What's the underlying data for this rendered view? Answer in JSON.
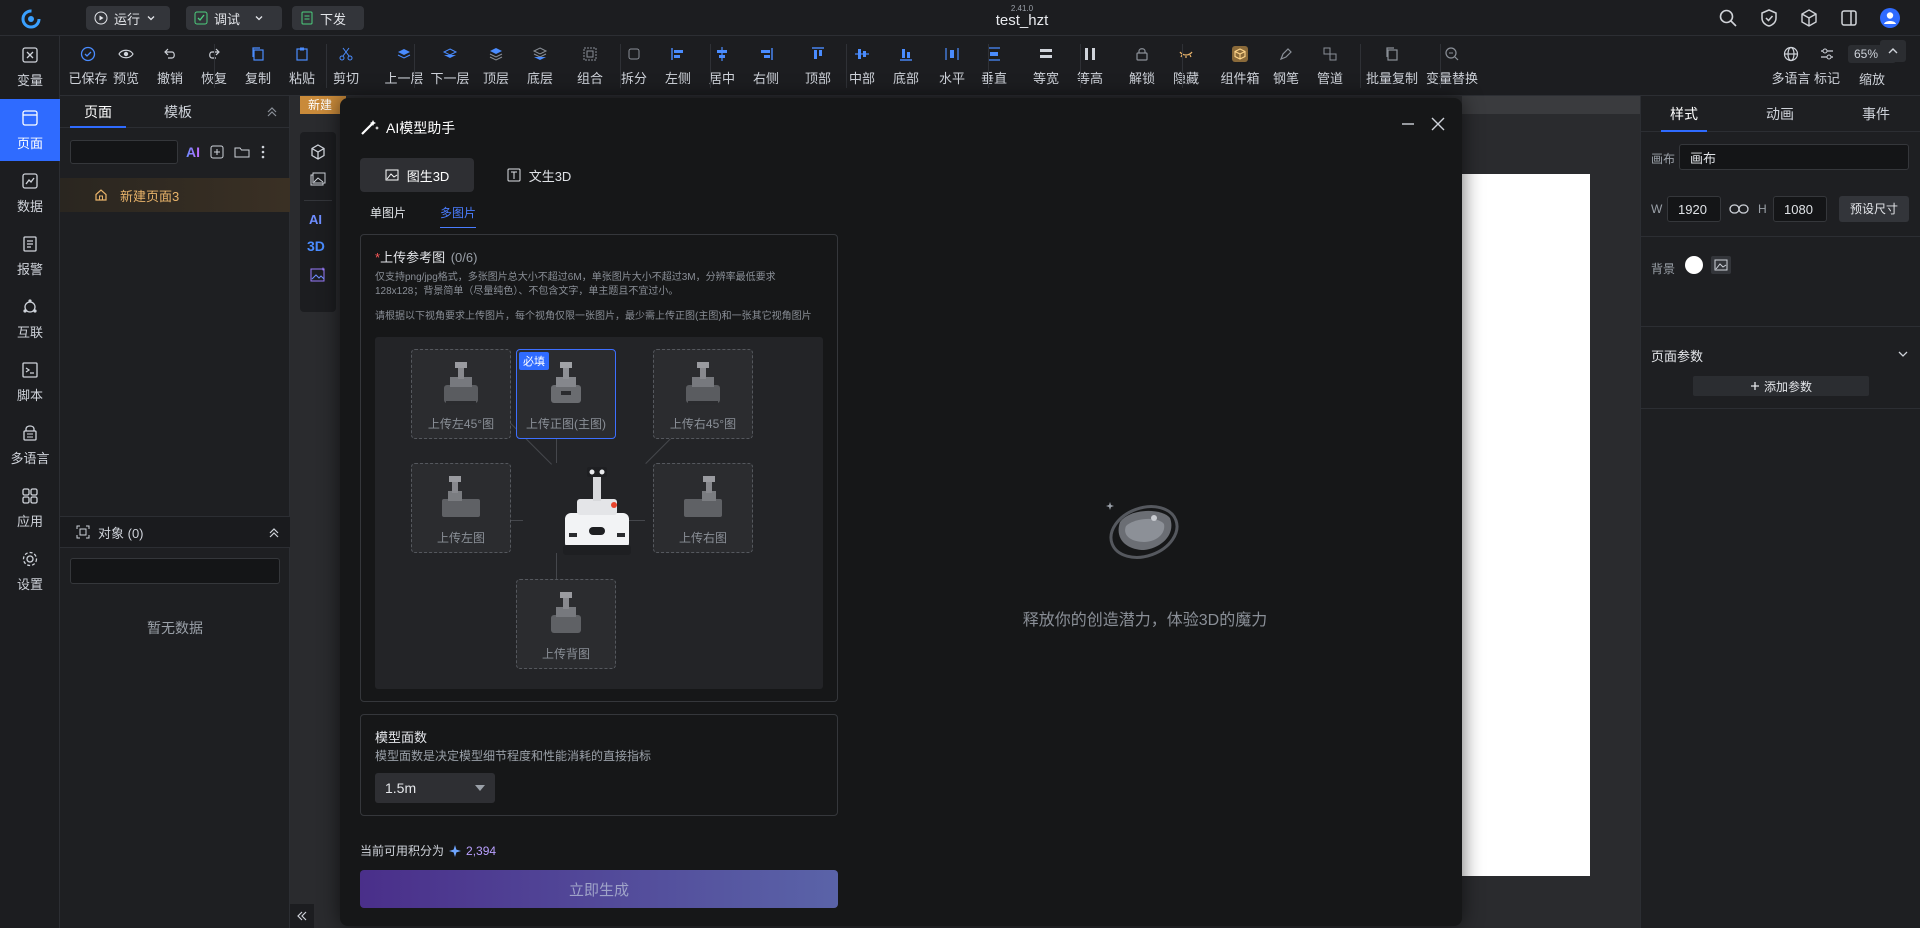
{
  "app": {
    "version": "2.41.0",
    "title": "test_hzt",
    "run_label": "运行",
    "debug_label": "调试",
    "deploy_label": "下发"
  },
  "toolbar": [
    {
      "id": "saved",
      "label": "已保存",
      "icon": "check-circle-icon"
    },
    {
      "id": "preview",
      "label": "预览",
      "icon": "eye-icon"
    },
    {
      "id": "undo",
      "label": "撤销",
      "icon": "undo-icon"
    },
    {
      "id": "redo",
      "label": "恢复",
      "icon": "redo-icon"
    },
    {
      "id": "copy",
      "label": "复制",
      "icon": "copy-icon"
    },
    {
      "id": "paste",
      "label": "粘贴",
      "icon": "paste-icon"
    },
    {
      "id": "cut",
      "label": "剪切",
      "icon": "scissors-icon"
    },
    {
      "id": "up-layer",
      "label": "上一层",
      "icon": "layer-up-icon"
    },
    {
      "id": "down-layer",
      "label": "下一层",
      "icon": "layer-down-icon"
    },
    {
      "id": "top-layer",
      "label": "顶层",
      "icon": "layer-top-icon"
    },
    {
      "id": "bottom-layer",
      "label": "底层",
      "icon": "layer-bottom-icon"
    },
    {
      "id": "group",
      "label": "组合",
      "icon": "group-icon"
    },
    {
      "id": "ungroup",
      "label": "拆分",
      "icon": "ungroup-icon"
    },
    {
      "id": "align-left",
      "label": "左侧",
      "icon": "align-left-icon"
    },
    {
      "id": "align-center",
      "label": "居中",
      "icon": "align-center-icon"
    },
    {
      "id": "align-right",
      "label": "右侧",
      "icon": "align-right-icon"
    },
    {
      "id": "align-top",
      "label": "顶部",
      "icon": "align-top-icon"
    },
    {
      "id": "align-middle",
      "label": "中部",
      "icon": "align-middle-icon"
    },
    {
      "id": "align-bottom",
      "label": "底部",
      "icon": "align-bottom-icon"
    },
    {
      "id": "horizontal",
      "label": "水平",
      "icon": "distribute-h-icon"
    },
    {
      "id": "vertical",
      "label": "垂直",
      "icon": "distribute-v-icon"
    },
    {
      "id": "same-width",
      "label": "等宽",
      "icon": "same-width-icon"
    },
    {
      "id": "same-height",
      "label": "等高",
      "icon": "same-height-icon"
    },
    {
      "id": "unlock",
      "label": "解锁",
      "icon": "lock-icon"
    },
    {
      "id": "hide",
      "label": "隐藏",
      "icon": "eye-closed-icon"
    },
    {
      "id": "component-box",
      "label": "组件箱",
      "icon": "box-icon"
    },
    {
      "id": "pen",
      "label": "钢笔",
      "icon": "pen-icon"
    },
    {
      "id": "pipe",
      "label": "管道",
      "icon": "pipe-icon"
    },
    {
      "id": "batch-copy",
      "label": "批量复制",
      "icon": "batch-copy-icon"
    },
    {
      "id": "var-replace",
      "label": "变量替换",
      "icon": "var-replace-icon"
    }
  ],
  "toolbar_right": {
    "lang_label": "多语言",
    "mark_label": "标记",
    "zoom_label": "缩放",
    "zoom_value": "65%"
  },
  "rail": [
    {
      "label": "变量",
      "icon": "variable-icon"
    },
    {
      "label": "页面",
      "icon": "page-icon",
      "active": true
    },
    {
      "label": "数据",
      "icon": "data-icon"
    },
    {
      "label": "报警",
      "icon": "alarm-icon"
    },
    {
      "label": "互联",
      "icon": "connect-icon"
    },
    {
      "label": "脚本",
      "icon": "script-icon"
    },
    {
      "label": "多语言",
      "icon": "language-icon"
    },
    {
      "label": "应用",
      "icon": "apps-icon"
    },
    {
      "label": "设置",
      "icon": "settings-icon"
    }
  ],
  "left_panel": {
    "tabs": [
      "页面",
      "模板"
    ],
    "page_item": "新建页面3",
    "objects_title": "对象 (0)",
    "empty_text": "暂无数据"
  },
  "canvas": {
    "tab_label": "新建"
  },
  "modal": {
    "title": "AI模型助手",
    "mode_tabs": [
      "图生3D",
      "文生3D"
    ],
    "sub_tabs": [
      "单图片",
      "多图片"
    ],
    "upload_title": "上传参考图",
    "upload_required_mark": "*",
    "upload_count": "(0/6)",
    "upload_desc_1": "仅支持png/jpg格式，多张图片总大小不超过6M，单张图片大小不超过3M，分辨率最低要求128x128；背景简单（尽量纯色）、不包含文字，单主题且不宜过小。",
    "upload_desc_2": "请根据以下视角要求上传图片，每个视角仅限一张图片，最少需上传正图(主图)和一张其它视角图片",
    "slots": {
      "left45": "上传左45°图",
      "front": "上传正图(主图)",
      "right45": "上传右45°图",
      "left": "上传左图",
      "right": "上传右图",
      "back": "上传背图",
      "required_badge": "必填"
    },
    "face_title": "模型面数",
    "face_desc": "模型面数是决定模型细节程度和性能消耗的直接指标",
    "face_value": "1.5m",
    "points_label": "当前可用积分为",
    "points_value": "2,394",
    "generate_label": "立即生成",
    "slogan": "释放你的创造潜力，体验3D的魔力"
  },
  "right_panel": {
    "tabs": [
      "样式",
      "动画",
      "事件"
    ],
    "canvas_label": "画布",
    "canvas_value": "画布",
    "w_label": "W",
    "w_value": "1920",
    "h_label": "H",
    "h_value": "1080",
    "preset_label": "预设尺寸",
    "bg_label": "背景",
    "params_title": "页面参数",
    "add_param": "添加参数"
  }
}
